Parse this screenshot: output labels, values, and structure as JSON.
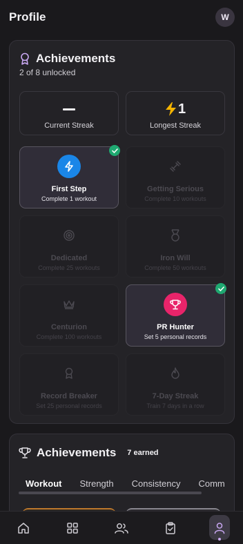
{
  "header": {
    "title": "Profile",
    "avatar_initial": "W"
  },
  "achievements_card": {
    "title": "Achievements",
    "subtitle": "2 of 8 unlocked",
    "stats": [
      {
        "value": "",
        "label": "Current Streak"
      },
      {
        "value": "1",
        "icon": "lightning-icon",
        "label": "Longest Streak"
      }
    ],
    "badges": [
      {
        "name": "First Step",
        "desc": "Complete 1 workout",
        "unlocked": true,
        "icon": "lightning-icon",
        "color": "#1a86e8"
      },
      {
        "name": "Getting Serious",
        "desc": "Complete 10 workouts",
        "unlocked": false,
        "icon": "dumbbell-icon"
      },
      {
        "name": "Dedicated",
        "desc": "Complete 25 workouts",
        "unlocked": false,
        "icon": "target-icon"
      },
      {
        "name": "Iron Will",
        "desc": "Complete 50 workouts",
        "unlocked": false,
        "icon": "medal-icon"
      },
      {
        "name": "Centurion",
        "desc": "Complete 100 workouts",
        "unlocked": false,
        "icon": "crown-icon"
      },
      {
        "name": "PR Hunter",
        "desc": "Set 5 personal records",
        "unlocked": true,
        "icon": "trophy-icon",
        "color": "#e8246a"
      },
      {
        "name": "Record Breaker",
        "desc": "Set 25 personal records",
        "unlocked": false,
        "icon": "award-icon"
      },
      {
        "name": "7-Day Streak",
        "desc": "Train 7 days in a row",
        "unlocked": false,
        "icon": "flame-icon"
      }
    ]
  },
  "earned_card": {
    "title": "Achievements",
    "earned": "7 earned",
    "tabs": [
      "Workout",
      "Strength",
      "Consistency",
      "Comm"
    ],
    "active_tab": "Workout"
  },
  "nav": {
    "items": [
      "home-icon",
      "grid-icon",
      "users-icon",
      "clipboard-icon",
      "profile-icon"
    ],
    "active": "profile-icon"
  },
  "colors": {
    "check": "#1fa971",
    "accent": "#c9a8f2",
    "first_step": "#1a86e8",
    "pr_hunter": "#e8246a"
  }
}
